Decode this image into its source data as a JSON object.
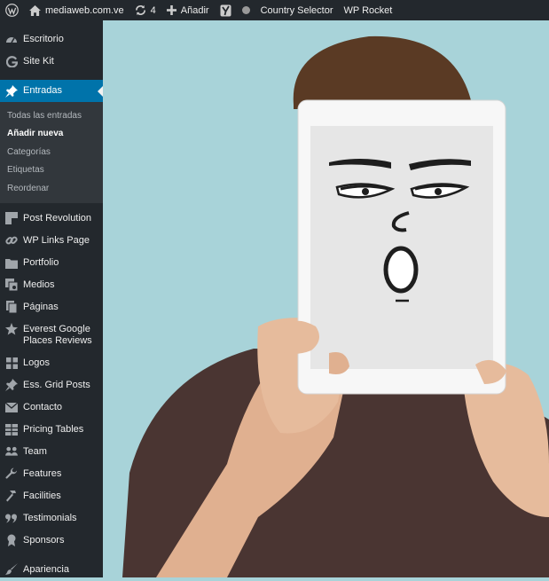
{
  "admin_bar": {
    "site_name": "mediaweb.com.ve",
    "updates_count": "4",
    "new_label": "Añadir",
    "country_selector_label": "Country Selector",
    "wp_rocket_label": "WP Rocket"
  },
  "sidebar": {
    "items": [
      {
        "label": "Escritorio",
        "icon": "dashboard-icon"
      },
      {
        "label": "Site Kit",
        "icon": "google-g-icon"
      },
      {
        "label": "Entradas",
        "icon": "pushpin-icon",
        "active": true
      },
      {
        "label": "Post Revolution",
        "icon": "post-revolution-icon"
      },
      {
        "label": "WP Links Page",
        "icon": "link-icon"
      },
      {
        "label": "Portfolio",
        "icon": "folder-icon"
      },
      {
        "label": "Medios",
        "icon": "media-icon"
      },
      {
        "label": "Páginas",
        "icon": "pages-icon"
      },
      {
        "label": "Everest Google Places Reviews",
        "icon": "star-icon"
      },
      {
        "label": "Logos",
        "icon": "grid-icon"
      },
      {
        "label": "Ess. Grid Posts",
        "icon": "pushpin-icon"
      },
      {
        "label": "Contacto",
        "icon": "envelope-icon"
      },
      {
        "label": "Pricing Tables",
        "icon": "table-icon"
      },
      {
        "label": "Team",
        "icon": "team-icon"
      },
      {
        "label": "Features",
        "icon": "wrench-icon"
      },
      {
        "label": "Facilities",
        "icon": "hammer-icon"
      },
      {
        "label": "Testimonials",
        "icon": "quote-icon"
      },
      {
        "label": "Sponsors",
        "icon": "sponsors-icon"
      },
      {
        "label": "Apariencia",
        "icon": "brush-icon"
      }
    ],
    "submenu": [
      {
        "label": "Todas las entradas"
      },
      {
        "label": "Añadir nueva",
        "current": true
      },
      {
        "label": "Categorías"
      },
      {
        "label": "Etiquetas"
      },
      {
        "label": "Reordenar"
      }
    ]
  },
  "colors": {
    "admin_dark": "#23282d",
    "submenu_bg": "#32373c",
    "active_blue": "#0073aa",
    "photo_background": "#a8d3d9",
    "shirt": "#4a3532"
  }
}
